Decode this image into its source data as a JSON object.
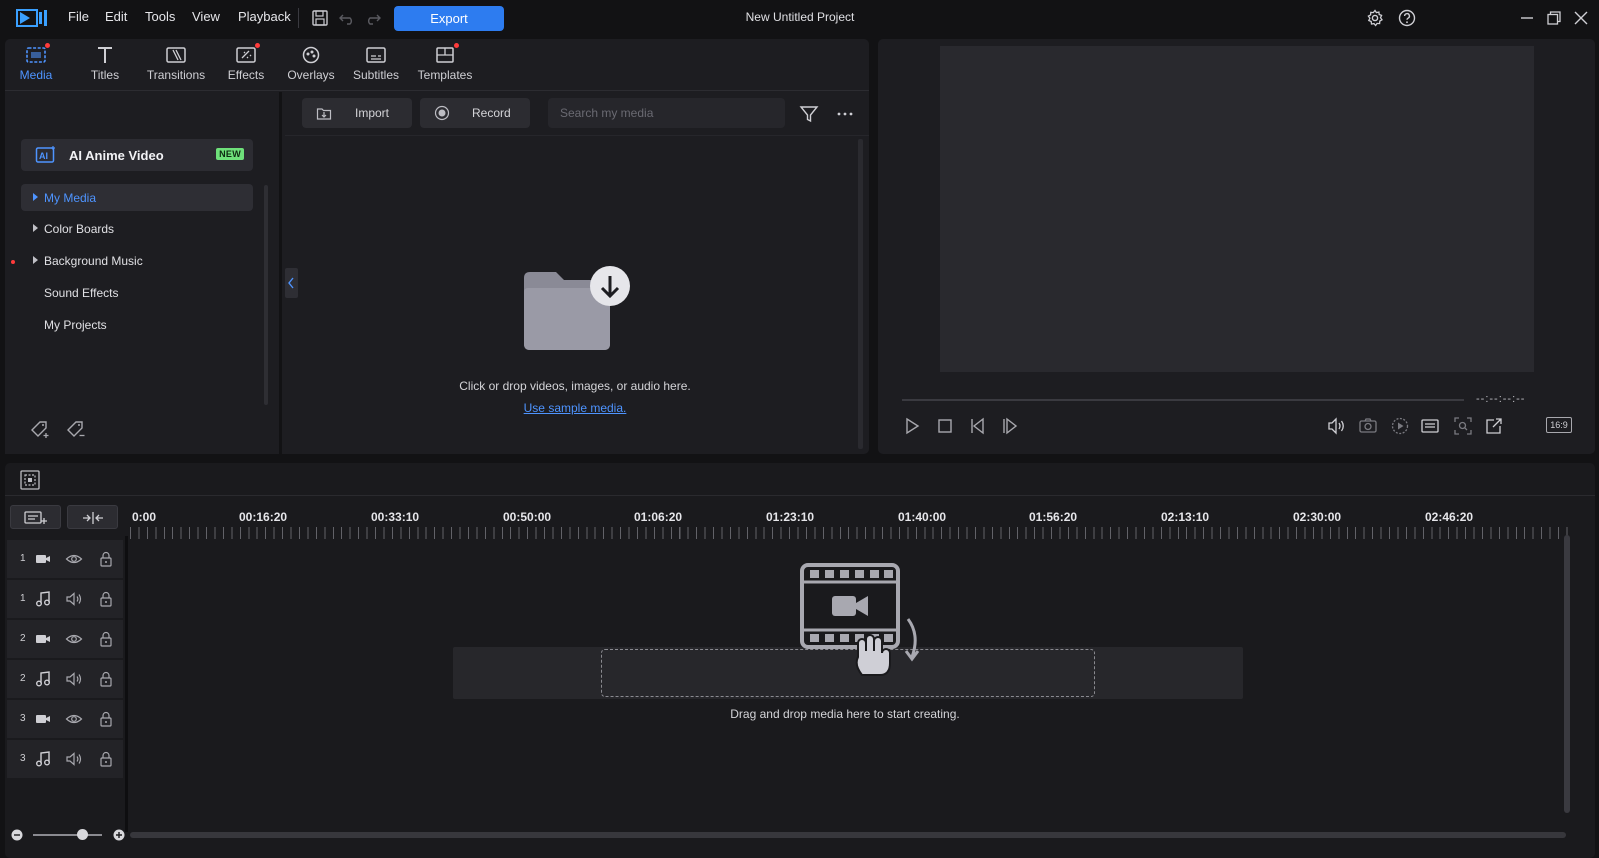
{
  "menu": {
    "file": "File",
    "edit": "Edit",
    "tools": "Tools",
    "view": "View",
    "playback": "Playback"
  },
  "toolbar": {
    "export_label": "Export"
  },
  "project_title": "New Untitled Project",
  "tabs": {
    "media": "Media",
    "titles": "Titles",
    "transitions": "Transitions",
    "effects": "Effects",
    "overlays": "Overlays",
    "subtitles": "Subtitles",
    "templates": "Templates"
  },
  "library": {
    "ai_anime_label": "AI Anime Video",
    "ai_anime_badge": "NEW",
    "items": [
      "My Media",
      "Color Boards",
      "Background Music",
      "Sound Effects",
      "My Projects"
    ]
  },
  "media": {
    "import_label": "Import",
    "record_label": "Record",
    "search_placeholder": "Search my media",
    "drop_hint": "Click or drop videos, images, or audio here.",
    "sample_link": "Use sample media."
  },
  "preview": {
    "timecode": "--:--:--:--",
    "aspect": "16:9"
  },
  "timeline": {
    "ticks": [
      "0:00",
      "00:16:20",
      "00:33:10",
      "00:50:00",
      "01:06:20",
      "01:23:10",
      "01:40:00",
      "01:56:20",
      "02:13:10",
      "02:30:00",
      "02:46:20"
    ],
    "tracks": [
      "1",
      "1",
      "2",
      "2",
      "3",
      "3"
    ],
    "drop_hint": "Drag and drop media here to start creating."
  },
  "colors": {
    "accent": "#2d7cf0",
    "active_text": "#4e94ff",
    "badge_new": "#6ee07a",
    "notification_dot": "#ff3b3b"
  }
}
